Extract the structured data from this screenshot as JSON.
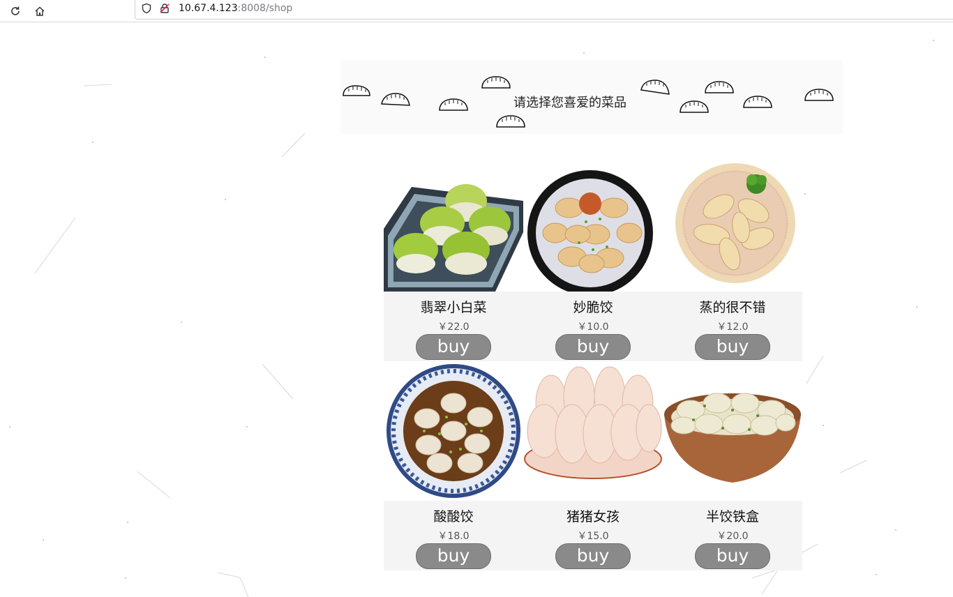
{
  "browser": {
    "url_host": "10.67.4.123",
    "url_rest": ":8008/shop"
  },
  "banner": {
    "title": "请选择您喜爱的菜品"
  },
  "products": [
    {
      "name": "翡翠小白菜",
      "price": "￥22.0",
      "buy_label": "buy",
      "image": "jade-dumplings-plate"
    },
    {
      "name": "妙脆饺",
      "price": "￥10.0",
      "buy_label": "buy",
      "image": "fried-dumplings-bowl"
    },
    {
      "name": "蒸的很不错",
      "price": "￥12.0",
      "buy_label": "buy",
      "image": "steamed-dumplings-basket"
    },
    {
      "name": "酸酸饺",
      "price": "￥18.0",
      "buy_label": "buy",
      "image": "sour-soup-dumplings-bowl"
    },
    {
      "name": "猪猪女孩",
      "price": "￥15.0",
      "buy_label": "buy",
      "image": "pork-dumplings-plate"
    },
    {
      "name": "半饺铁盒",
      "price": "￥20.0",
      "buy_label": "buy",
      "image": "dumplings-wooden-bowl"
    }
  ],
  "colors": {
    "button_bg": "#8a8a8a",
    "card_info_bg": "#f4f4f4",
    "banner_bg": "#fafafa"
  }
}
